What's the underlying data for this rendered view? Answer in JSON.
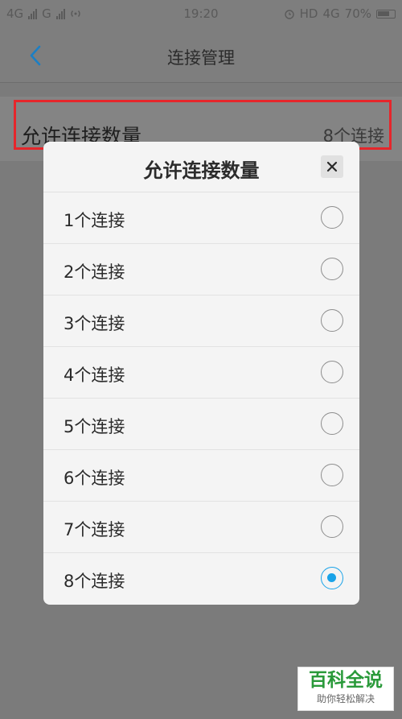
{
  "status_bar": {
    "signal_left_1": "4G",
    "signal_left_2": "G",
    "time": "19:20",
    "hd": "HD",
    "network": "4G",
    "battery": "70%"
  },
  "app_bar": {
    "title": "连接管理",
    "back_icon": "chevron-left-icon"
  },
  "setting_row": {
    "label": "允许连接数量",
    "value": "8个连接"
  },
  "dialog": {
    "title": "允许连接数量",
    "close_icon": "close-icon",
    "selected_index": 7,
    "options": [
      {
        "label": "1个连接"
      },
      {
        "label": "2个连接"
      },
      {
        "label": "3个连接"
      },
      {
        "label": "4个连接"
      },
      {
        "label": "5个连接"
      },
      {
        "label": "6个连接"
      },
      {
        "label": "7个连接"
      },
      {
        "label": "8个连接"
      }
    ]
  },
  "watermark": {
    "main": "百科全说",
    "sub": "助你轻松解决"
  },
  "colors": {
    "accent": "#1aa3e8",
    "highlight_border": "#e6262b",
    "watermark_green": "#2a9a3a"
  }
}
